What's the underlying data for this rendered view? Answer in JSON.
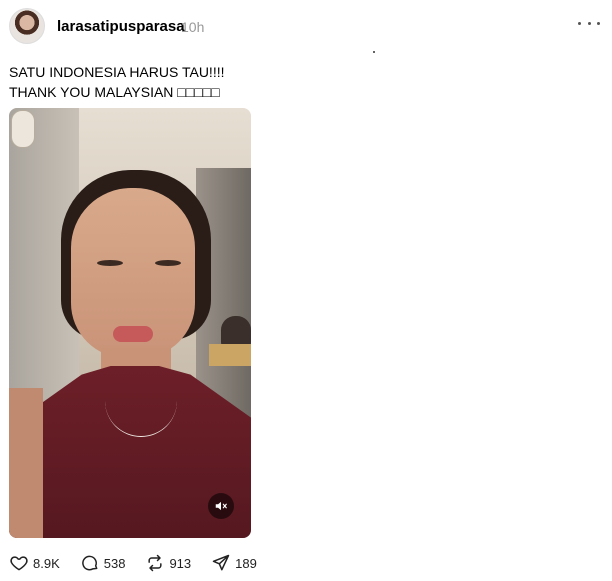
{
  "post": {
    "username": "larasatipusparasa",
    "timestamp": "10h",
    "caption_lines": [
      "SATU INDONESIA HARUS TAU!!!!",
      "THANK YOU MALAYSIAN □□□□□"
    ]
  },
  "actions": {
    "like_count": "8.9K",
    "comment_count": "538",
    "repost_count": "913",
    "share_count": "189"
  },
  "icons": {
    "more": "more-horizontal-icon",
    "mute": "volume-off-icon",
    "like": "heart-icon",
    "comment": "comment-bubble-icon",
    "repost": "repost-icon",
    "share": "send-icon"
  }
}
